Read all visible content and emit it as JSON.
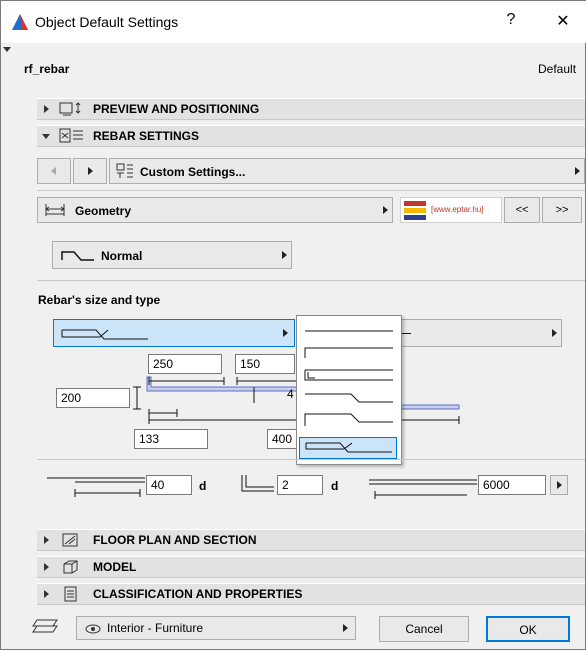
{
  "window": {
    "title": "Object Default Settings",
    "help": "?",
    "close": "✕"
  },
  "header": {
    "object_name": "rf_rebar",
    "default_label": "Default"
  },
  "sections": {
    "preview": "PREVIEW AND POSITIONING",
    "rebar": "REBAR SETTINGS",
    "floor_plan": "FLOOR PLAN AND SECTION",
    "model": "MODEL",
    "classification": "CLASSIFICATION AND PROPERTIES"
  },
  "rebar": {
    "custom_settings": "Custom Settings...",
    "geometry": "Geometry",
    "logo_text": "[www.eptar.hu]",
    "nav_prev": "<<",
    "nav_next": ">>",
    "normal": "Normal",
    "size_type_label": "Rebar's size and type"
  },
  "dimensions": {
    "d250": "250",
    "d150": "150",
    "d4": "4",
    "d200": "200",
    "d133": "133",
    "d400": "400"
  },
  "bottom_row": {
    "val1": "40",
    "unit1": "d",
    "val2": "2",
    "unit2": "d",
    "val3": "6000"
  },
  "footer": {
    "layer": "Interior - Furniture",
    "cancel": "Cancel",
    "ok": "OK"
  },
  "colors": {
    "selected_bg": "#cce4f7",
    "selected_border": "#0078d7",
    "rebar_blue": "#6b7fc4"
  }
}
